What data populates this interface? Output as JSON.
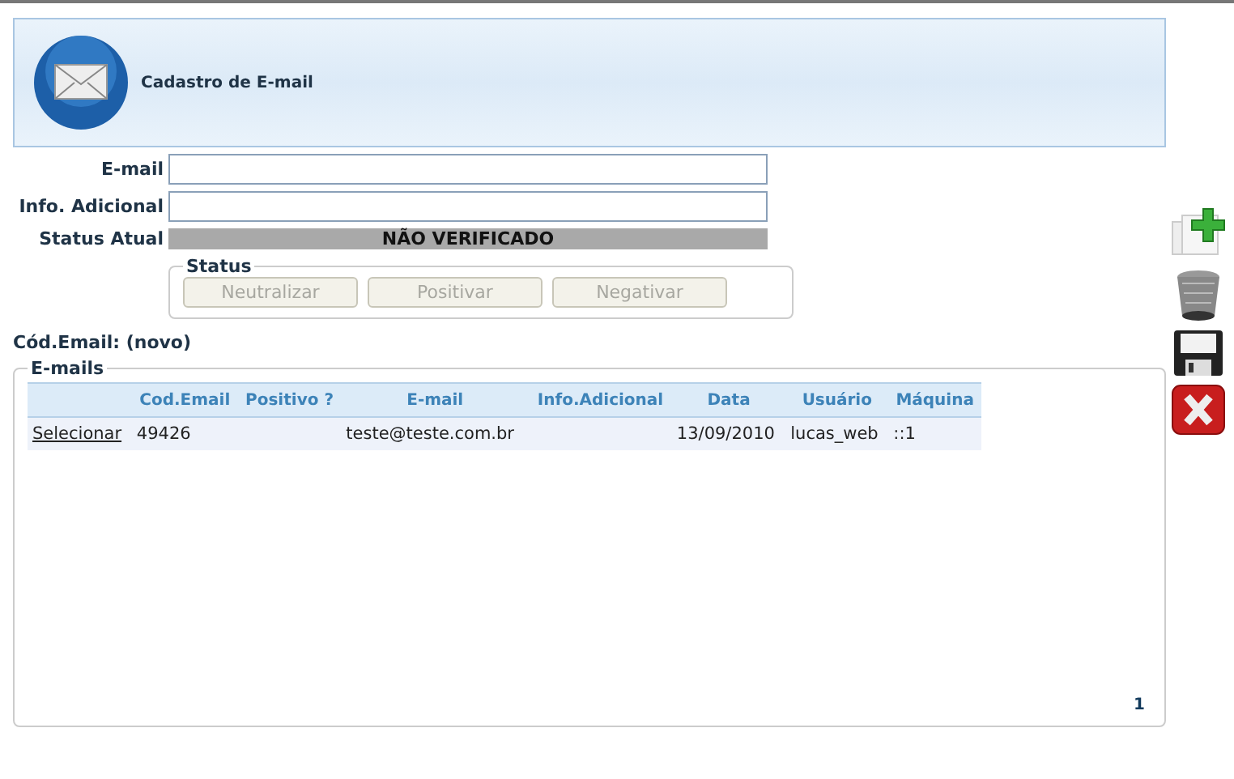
{
  "header": {
    "title": "Cadastro de E-mail"
  },
  "form": {
    "fields": [
      {
        "label": "E-mail"
      },
      {
        "label": "Info. Adicional"
      }
    ],
    "status": {
      "label": "Status Atual",
      "value": "NÃO VERIFICADO"
    }
  },
  "status_group": {
    "legend": "Status",
    "buttons": [
      {
        "label": "Neutralizar",
        "disabled": true
      },
      {
        "label": "Positivar",
        "disabled": true
      },
      {
        "label": "Negativar",
        "disabled": true
      }
    ]
  },
  "code_line": "Cód.Email: (novo)",
  "emails": {
    "legend": "E-mails",
    "columns": [
      null,
      "Cod.Email",
      "Positivo ?",
      "E-mail",
      "Info.Adicional",
      "Data",
      "Usuário",
      "Máquina"
    ],
    "rows": [
      {
        "cells": [
          "Selecionar",
          "49426",
          "",
          "teste@teste.com.br",
          "",
          "13/09/2010",
          "lucas_web",
          "::1"
        ]
      }
    ],
    "pages": [
      {
        "label": "1",
        "selected": true
      }
    ]
  },
  "toolbar": [
    {
      "kind": "add"
    },
    {
      "kind": "delete"
    },
    {
      "kind": "save"
    },
    {
      "kind": "cancel"
    }
  ]
}
